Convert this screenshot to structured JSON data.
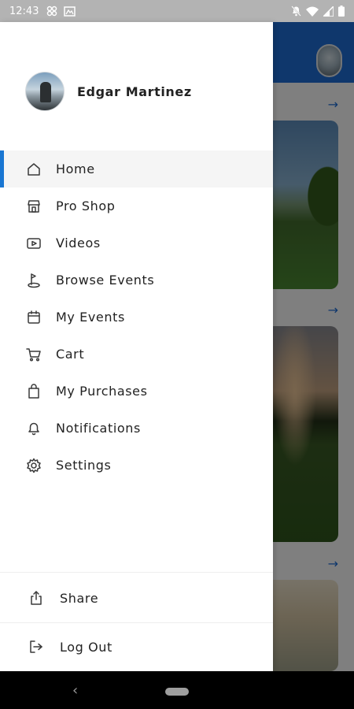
{
  "status_bar": {
    "time": "12:43",
    "left_icons": [
      "grid-icon",
      "gallery-icon"
    ],
    "right_icons": [
      "bell-off-icon",
      "wifi-icon",
      "signal-icon",
      "battery-icon"
    ]
  },
  "colors": {
    "accent": "#1976d2",
    "appbar": "#1e6fd9",
    "status_bar": "#b3b3b3",
    "nav_bar": "#000000"
  },
  "profile": {
    "name": "Edgar Martinez"
  },
  "menu": {
    "items": [
      {
        "label": "Home",
        "icon": "home-icon",
        "active": true
      },
      {
        "label": "Pro Shop",
        "icon": "store-icon",
        "active": false
      },
      {
        "label": "Videos",
        "icon": "video-icon",
        "active": false
      },
      {
        "label": "Browse Events",
        "icon": "golf-flag-icon",
        "active": false
      },
      {
        "label": "My Events",
        "icon": "calendar-icon",
        "active": false
      },
      {
        "label": "Cart",
        "icon": "cart-icon",
        "active": false
      },
      {
        "label": "My Purchases",
        "icon": "shopping-bag-icon",
        "active": false
      },
      {
        "label": "Notifications",
        "icon": "bell-icon",
        "active": false
      },
      {
        "label": "Settings",
        "icon": "gear-icon",
        "active": false
      }
    ]
  },
  "footer": {
    "share_label": "Share",
    "logout_label": "Log Out"
  }
}
